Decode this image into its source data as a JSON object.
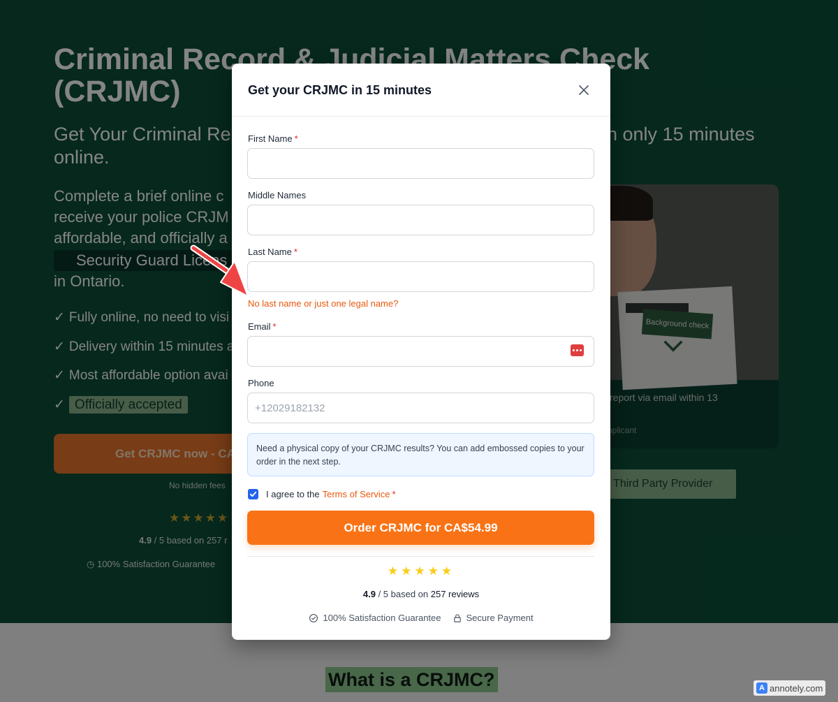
{
  "background": {
    "title": "Criminal Record & Judicial Matters Check (CRJMC)",
    "subtitle_left": "Get Your Criminal Re",
    "subtitle_left_2": "online.",
    "subtitle_right": "n only 15 minutes",
    "desc_lines": [
      "Complete a brief online c",
      "receive your police CRJM",
      "affordable, and officially a"
    ],
    "desc_pill": "Security Guard Licens",
    "desc_end": "in Ontario.",
    "checks": [
      {
        "check": "✓",
        "text": "Fully online, no need to visi"
      },
      {
        "check": "✓",
        "text": "Delivery within 15 minutes a"
      },
      {
        "check": "✓",
        "text": "Most affordable option avai"
      },
      {
        "check": "✓",
        "text": "Officially accepted"
      }
    ],
    "cta": "Get CRJMC now - CA",
    "cta_note": "No hidden fees",
    "stars": "★★★★★",
    "rating_score": "4.9",
    "rating_rest": "/ 5 based on 257 r",
    "guarantee": "100% Satisfaction Guarantee",
    "card_photo_tag": "Background check",
    "card_text": "report via email within 13",
    "card_who": "pplicant",
    "provider": "d Third Party Provider",
    "section_title": "What is a CRJMC?"
  },
  "modal": {
    "title": "Get your CRJMC in 15 minutes",
    "fields": {
      "first_name": {
        "label": "First Name",
        "required": "*",
        "value": ""
      },
      "middle_names": {
        "label": "Middle Names",
        "value": ""
      },
      "last_name": {
        "label": "Last Name",
        "required": "*",
        "value": "",
        "error": "No last name or just one legal name?"
      },
      "email": {
        "label": "Email",
        "required": "*",
        "value": ""
      },
      "phone": {
        "label": "Phone",
        "placeholder": "+12029182132",
        "value": ""
      }
    },
    "info": "Need a physical copy of your CRJMC results? You can add embossed copies to your order in the next step.",
    "agree_text": "I agree to the",
    "tos_link": "Terms of Service",
    "agree_required": "*",
    "agree_checked": true,
    "order_button": "Order CRJMC for CA$54.99",
    "stars": "★★★★★",
    "rating_score": "4.9",
    "rating_mid": "/ 5 based on",
    "rating_count": "257 reviews",
    "trust_guarantee": "100% Satisfaction Guarantee",
    "trust_secure": "Secure Payment"
  },
  "watermark": "annotely.com",
  "watermark_logo": "A",
  "colors": {
    "accent": "#f97316",
    "error": "#ea580c",
    "required": "#dc2626",
    "checkbox": "#2563eb",
    "annotation_arrow": "#ef4444",
    "page_green": "#0c4e39"
  }
}
